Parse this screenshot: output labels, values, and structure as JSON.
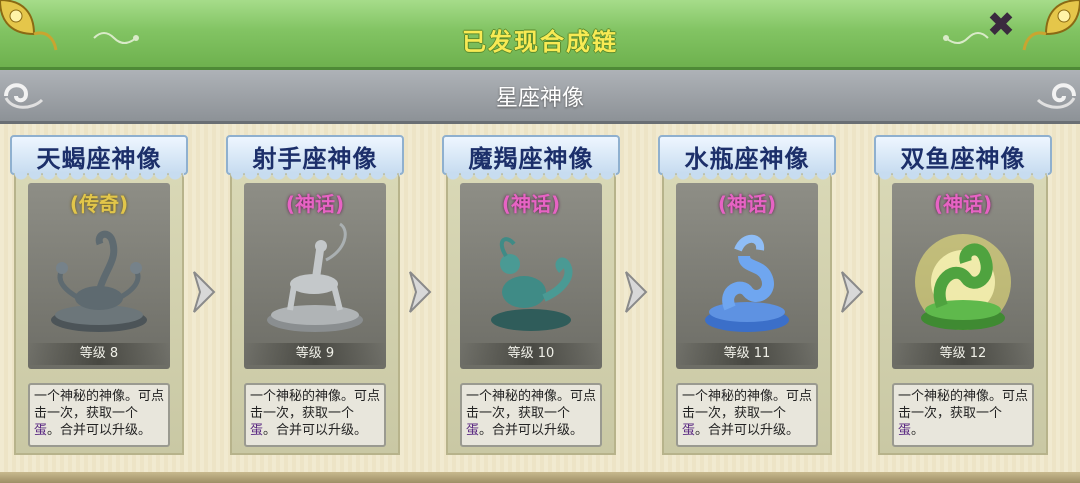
{
  "header": {
    "title": "已发现合成链",
    "close_label": "✖"
  },
  "subheader": {
    "name": "星座神像"
  },
  "cards": [
    {
      "name": "天蝎座神像",
      "rarity": "(传奇)",
      "level": "等级 8",
      "desc_text": "一个神秘的神像。可点击一次，获取一个",
      "desc_egg": "蛋",
      "desc_tail": "。合并可以升级。"
    },
    {
      "name": "射手座神像",
      "rarity": "(神话)",
      "level": "等级 9",
      "desc_text": "一个神秘的神像。可点击一次，获取一个",
      "desc_egg": "蛋",
      "desc_tail": "。合并可以升级。"
    },
    {
      "name": "魔羯座神像",
      "rarity": "(神话)",
      "level": "等级 10",
      "desc_text": "一个神秘的神像。可点击一次，获取一个",
      "desc_egg": "蛋",
      "desc_tail": "。合并可以升级。"
    },
    {
      "name": "水瓶座神像",
      "rarity": "(神话)",
      "level": "等级 11",
      "desc_text": "一个神秘的神像。可点击一次，获取一个",
      "desc_egg": "蛋",
      "desc_tail": "。合并可以升级。"
    },
    {
      "name": "双鱼座神像",
      "rarity": "(神话)",
      "level": "等级 12",
      "desc_text": "一个神秘的神像。可点击一次，获取一个",
      "desc_egg": "蛋",
      "desc_tail": "。"
    }
  ],
  "colors": {
    "legendary": "#e2c64a",
    "mythic": "#e763c4",
    "header_green": "#82c463",
    "title_yellow": "#f8ea54"
  }
}
